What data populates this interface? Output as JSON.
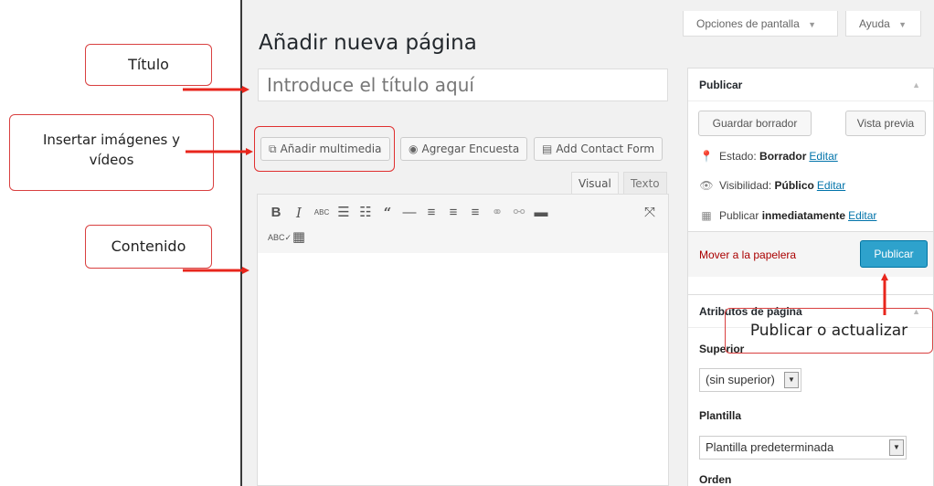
{
  "header": {
    "screen_options_label": "Opciones de pantalla",
    "help_label": "Ayuda",
    "page_title": "Añadir nueva página"
  },
  "editor": {
    "title_placeholder": "Introduce el título aquí",
    "add_media_label": "Añadir multimedia",
    "add_poll_label": "Agregar Encuesta",
    "add_contact_form_label": "Add Contact Form",
    "tab_visual": "Visual",
    "tab_text": "Texto",
    "toolbar_icons": [
      "bold-icon",
      "italic-icon",
      "strikethrough-icon",
      "bullet-list-icon",
      "numbered-list-icon",
      "blockquote-icon",
      "horizontal-rule-icon",
      "align-left-icon",
      "align-center-icon",
      "align-right-icon",
      "insert-link-icon",
      "remove-link-icon",
      "read-more-icon",
      "fullscreen-icon",
      "spellcheck-icon",
      "toolbar-toggle-icon"
    ]
  },
  "publish_box": {
    "title": "Publicar",
    "save_draft_label": "Guardar borrador",
    "preview_label": "Vista previa",
    "status_prefix": "Estado:",
    "status_value": "Borrador",
    "visibility_prefix": "Visibilidad:",
    "visibility_value": "Público",
    "publish_prefix": "Publicar",
    "publish_value": "inmediatamente",
    "edit_link": "Editar",
    "trash_label": "Mover a la papelera",
    "publish_button": "Publicar"
  },
  "page_attributes": {
    "title": "Atributos de página",
    "parent_label": "Superior",
    "parent_value": "(sin superior)",
    "template_label": "Plantilla",
    "template_value": "Plantilla predeterminada",
    "order_label": "Orden"
  },
  "annotations": {
    "title_callout": "Título",
    "media_callout_line1": "Insertar imágenes y",
    "media_callout_line2": "vídeos",
    "content_callout": "Contenido",
    "publish_callout": "Publicar o actualizar"
  },
  "colors": {
    "annotation_red": "#e8261c",
    "publish_blue": "#2ea2cc",
    "link_blue": "#0073aa",
    "trash_red": "#a00000"
  }
}
